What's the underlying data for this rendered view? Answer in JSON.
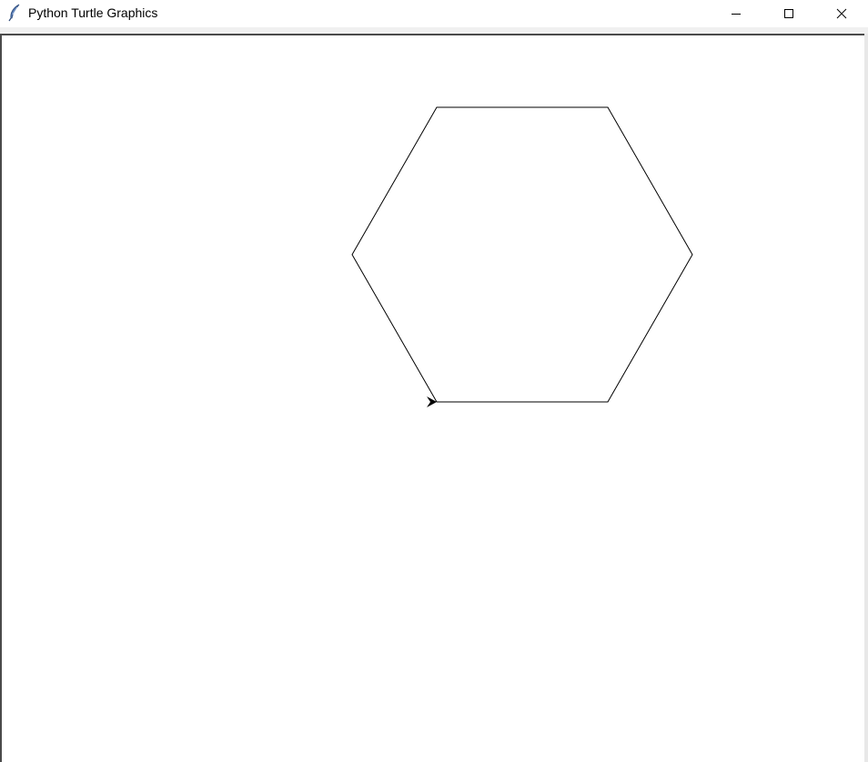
{
  "window": {
    "title": "Python Turtle Graphics"
  },
  "titlebar": {
    "app_icon": "feather-icon",
    "buttons": [
      {
        "name": "minimize",
        "icon": "minimize-icon"
      },
      {
        "name": "maximize",
        "icon": "maximize-icon"
      },
      {
        "name": "close",
        "icon": "close-icon"
      }
    ]
  },
  "canvas": {
    "background": "#ffffff",
    "stroke_color": "#000000",
    "shape": "hexagon",
    "turtle_icon": "turtle-arrow-icon"
  }
}
